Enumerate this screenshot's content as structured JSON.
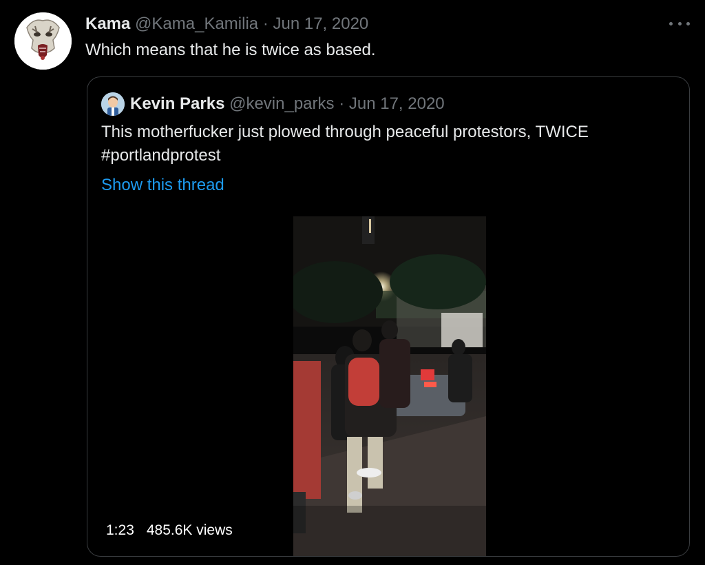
{
  "tweet": {
    "author_name": "Kama",
    "author_handle": "@Kama_Kamilia",
    "separator": " · ",
    "date": "Jun 17, 2020",
    "text": "Which means that he is twice as based.",
    "avatar_icon": "skull-mask-avatar",
    "more_icon": "more-horizontal-icon"
  },
  "quoted_tweet": {
    "author_name": "Kevin Parks",
    "author_handle": "@kevin_parks",
    "separator": " · ",
    "date": "Jun 17, 2020",
    "text_line1": "This motherfucker just plowed through peaceful protestors, TWICE",
    "text_line2": "#portlandprotest",
    "show_thread_label": "Show this thread",
    "avatar_icon": "cartoon-person-avatar",
    "video": {
      "duration": "1:23",
      "views": "485.6K views"
    }
  },
  "colors": {
    "background": "#000000",
    "text": "#e7e9ea",
    "muted": "#71767b",
    "link": "#1d9bf0",
    "border": "#3a3d40"
  }
}
